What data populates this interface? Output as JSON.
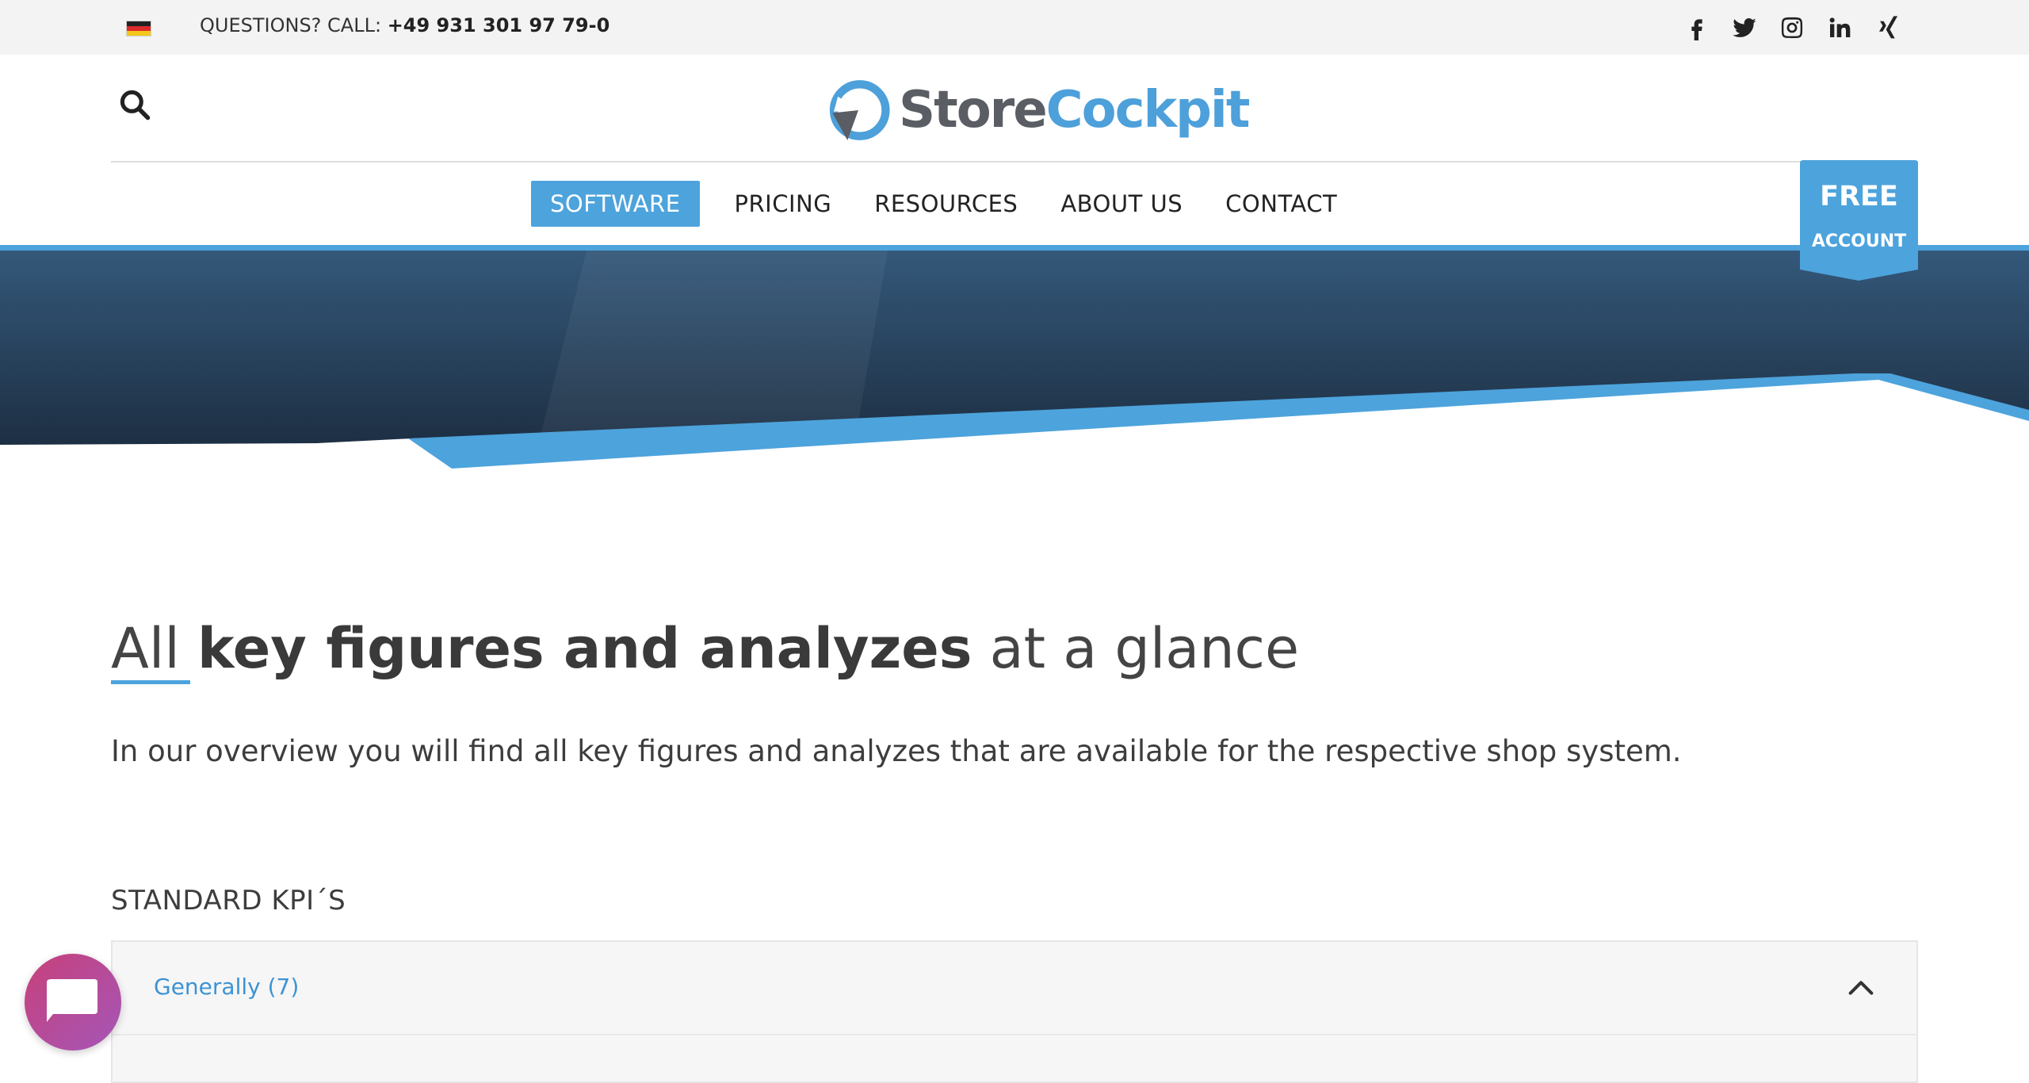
{
  "topbar": {
    "language_flag": "german-flag-icon",
    "questions_label": "QUESTIONS? CALL:",
    "phone_number": "+49 931 301 97 79-0",
    "social_icons": [
      "facebook-icon",
      "twitter-icon",
      "instagram-icon",
      "linkedin-icon",
      "xing-icon"
    ]
  },
  "header": {
    "search_icon": "search-icon",
    "logo_part1": "Store",
    "logo_part2": "Cockpit"
  },
  "nav": {
    "items": [
      {
        "label": "SOFTWARE",
        "active": true
      },
      {
        "label": "PRICING",
        "active": false
      },
      {
        "label": "RESOURCES",
        "active": false
      },
      {
        "label": "ABOUT US",
        "active": false
      },
      {
        "label": "CONTACT",
        "active": false
      }
    ]
  },
  "cta": {
    "line1": "FREE",
    "line2": "ACCOUNT"
  },
  "main": {
    "title_part1": "All ",
    "title_bold": "key figures and analyzes",
    "title_part2": " at a glance",
    "lead": "In our overview you will find all key figures and analyzes that are available for the respective shop system.",
    "section_title": "STANDARD KPI´S",
    "accordion": [
      {
        "label": "Generally (7)",
        "expanded": true
      }
    ]
  },
  "colors": {
    "accent": "#4da3dc",
    "hero_dark": "#243a52",
    "chat_gradient_start": "#c8407a",
    "chat_gradient_end": "#a456b8"
  }
}
